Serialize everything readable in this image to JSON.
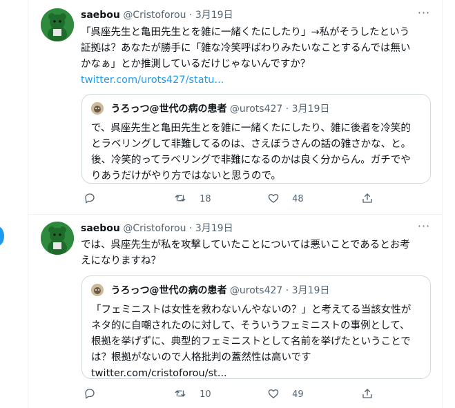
{
  "tweets": [
    {
      "author_name": "saebou",
      "author_handle": "@Cristoforou",
      "separator": "·",
      "date": "3月19日",
      "more": "···",
      "text_lines": [
        "「呉座先生と亀田先生とを雑に一緒くたにしたり」→私がそうしたという",
        "証拠は？あなたが勝手に「雑な冷笑呼ばわりみたいなことするんでは無い",
        "かなぁ」とか推測しているだけじゃないんですか？"
      ],
      "link": "twitter.com/urots427/statu...",
      "quote": {
        "name": "うろっつ@世代の病の患者",
        "handle": "@urots427",
        "separator": "·",
        "date": "3月19日",
        "lines": [
          "で、呉座先生と亀田先生とを雑に一緒くたにしたり、雑に後者を冷笑的",
          "とラベリングして非難してるのは、さえぼうさんの話の雑さかな、と。",
          "後、冷笑的ってラベリングで非難になるのかは良く分からん。ガチでや",
          "りあうだけがやり方ではないと思うので。"
        ]
      },
      "retweets": "18",
      "likes": "48"
    },
    {
      "author_name": "saebou",
      "author_handle": "@Cristoforou",
      "separator": "·",
      "date": "3月19日",
      "more": "···",
      "text_lines": [
        "では、呉座先生が私を攻撃していたことについては悪いことであるとお考",
        "えになりますね？"
      ],
      "quote": {
        "name": "うろっつ@世代の病の患者",
        "handle": "@urots427",
        "separator": "·",
        "date": "3月19日",
        "lines": [
          "「フェミニストは女性を救わないんやないの？」と考えてる当該女性が",
          "ネタ的に自嘲されたのに対して、そういうフェミニストの事例として、",
          "根拠を挙げずに、典型的フェミニストとして名前を挙げたということで",
          "は？根拠がないので人格批判の蓋然性は高いです",
          "twitter.com/cristoforou/st..."
        ]
      },
      "retweets": "10",
      "likes": "49"
    }
  ],
  "icons": {
    "reply": "reply-icon",
    "retweet": "retweet-icon",
    "like": "heart-icon",
    "share": "share-icon",
    "more": "more-icon"
  },
  "colors": {
    "accent": "#1d9bf0",
    "text": "#0f1419",
    "muted": "#536471",
    "border": "#cfd9de",
    "divider": "#eff3f4"
  }
}
